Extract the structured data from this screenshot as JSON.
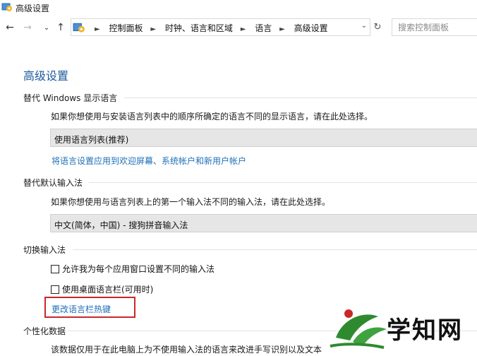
{
  "window": {
    "title": "高级设置"
  },
  "nav": {
    "back": "←",
    "forward": "→",
    "recent": "⌄",
    "up": "↑",
    "breadcrumbs": [
      "控制面板",
      "时钟、语言和区域",
      "语言",
      "高级设置"
    ],
    "dropdown": "⌄",
    "refresh": "↻",
    "search_placeholder": "搜索控制面板"
  },
  "page": {
    "title": "高级设置",
    "sections": {
      "display_language": {
        "heading": "替代 Windows 显示语言",
        "description": "如果你想使用与安装语言列表中的顺序所确定的语言不同的显示语言，请在此处选择。",
        "selected": "使用语言列表(推荐)",
        "link": "将语言设置应用到欢迎屏幕、系统帐户和新用户帐户"
      },
      "default_input": {
        "heading": "替代默认输入法",
        "description": "如果你想使用与语言列表上的第一个输入法不同的输入法，请在此处选择。",
        "selected": "中文(简体，中国) - 搜狗拼音输入法"
      },
      "switch_input": {
        "heading": "切换输入法",
        "checkbox1": "允许我为每个应用窗口设置不同的输入法",
        "checkbox2": "使用桌面语言栏(可用时)",
        "link": "更改语言栏热键"
      },
      "personalization": {
        "heading": "个性化数据",
        "description": "该数据仅用于在此电脑上为不使用输入法的语言来改进手写识别以及文本"
      }
    }
  },
  "watermark": {
    "text": "学知网",
    "color": "#2f8a2f"
  },
  "colors": {
    "accent_title": "#1b5a9c",
    "link": "#1e6fb8",
    "highlight_box": "#c8282a"
  }
}
